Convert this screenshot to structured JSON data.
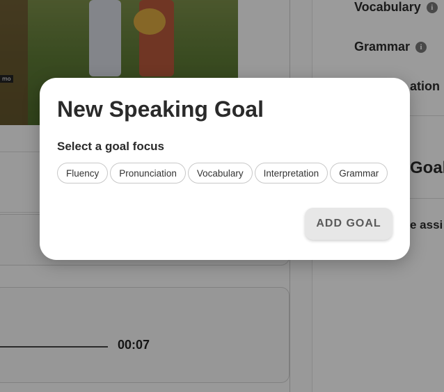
{
  "background": {
    "scene_caption": "mo",
    "sidebar": {
      "vocabulary_label": "Vocabulary",
      "grammar_label": "Grammar",
      "interpretation_label_partial": "ation",
      "goals_label_partial": "Goal",
      "assist_partial": "e assi",
      "info_glyph": "i"
    },
    "player": {
      "time": "00:07"
    }
  },
  "modal": {
    "title": "New Speaking Goal",
    "subtitle": "Select a goal focus",
    "chips": [
      "Fluency",
      "Pronunciation",
      "Vocabulary",
      "Interpretation",
      "Grammar"
    ],
    "add_button_label": "ADD GOAL"
  }
}
